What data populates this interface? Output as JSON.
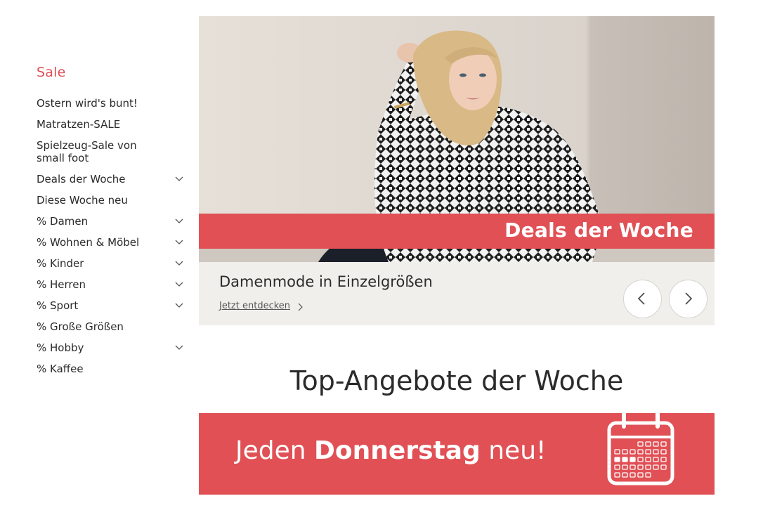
{
  "sidebar": {
    "title": "Sale",
    "items": [
      {
        "label": "Ostern wird's bunt!",
        "expandable": false
      },
      {
        "label": "Matratzen-SALE",
        "expandable": false
      },
      {
        "label": "Spielzeug-Sale von small foot",
        "expandable": false
      },
      {
        "label": "Deals der Woche",
        "expandable": true
      },
      {
        "label": "Diese Woche neu",
        "expandable": false
      },
      {
        "label": "% Damen",
        "expandable": true
      },
      {
        "label": "% Wohnen & Möbel",
        "expandable": true
      },
      {
        "label": "% Kinder",
        "expandable": true
      },
      {
        "label": "% Herren",
        "expandable": true
      },
      {
        "label": "% Sport",
        "expandable": true
      },
      {
        "label": "% Große Größen",
        "expandable": false
      },
      {
        "label": "% Hobby",
        "expandable": true
      },
      {
        "label": "% Kaffee",
        "expandable": false
      }
    ]
  },
  "hero": {
    "banner_text": "Deals der Woche",
    "caption": "Damenmode in Einzelgrößen",
    "link_label": "Jetzt entdecken",
    "prev_icon": "chevron-left-icon",
    "next_icon": "chevron-right-icon"
  },
  "section": {
    "title": "Top-Angebote der Woche"
  },
  "promo": {
    "text_prefix": "Jeden ",
    "text_bold": "Donnerstag",
    "text_suffix": " neu!",
    "icon": "calendar-icon"
  },
  "colors": {
    "accent": "#e05055",
    "text": "#2b2b2b",
    "hero_bg": "#f1efeb"
  }
}
